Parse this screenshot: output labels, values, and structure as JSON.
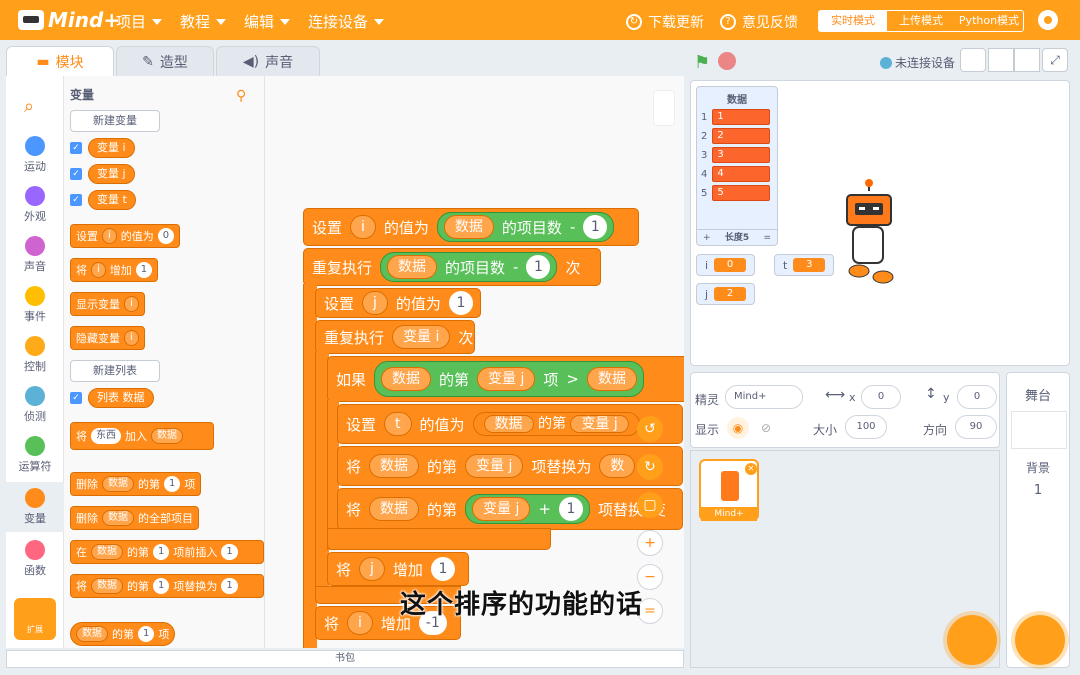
{
  "menubar": {
    "logo_text": "Mind+",
    "menus": [
      "项目",
      "教程",
      "编辑",
      "连接设备"
    ],
    "download_update": "下载更新",
    "feedback": "意见反馈",
    "modes": [
      "实时模式",
      "上传模式",
      "Python模式"
    ],
    "active_mode": "实时模式"
  },
  "tabs": {
    "blocks": "模块",
    "costumes": "造型",
    "sounds": "声音"
  },
  "categories": [
    {
      "label": "运动",
      "color": "#4c97ff"
    },
    {
      "label": "外观",
      "color": "#9966ff"
    },
    {
      "label": "声音",
      "color": "#cf63cf"
    },
    {
      "label": "事件",
      "color": "#ffbf00"
    },
    {
      "label": "控制",
      "color": "#ffab19"
    },
    {
      "label": "侦测",
      "color": "#5cb1d6"
    },
    {
      "label": "运算符",
      "color": "#59c059"
    },
    {
      "label": "变量",
      "color": "#ff8c1a"
    },
    {
      "label": "函数",
      "color": "#ff6680"
    }
  ],
  "extensions_label": "扩展",
  "palette": {
    "title": "变量",
    "new_variable": "新建变量",
    "variables": [
      "变量 i",
      "变量 j",
      "变量 t"
    ],
    "set_block": {
      "a": "设置",
      "var": "i",
      "b": "的值为",
      "val": "0"
    },
    "change_block": {
      "a": "将",
      "var": "i",
      "b": "增加",
      "val": "1"
    },
    "show_block": {
      "a": "显示变量",
      "var": "i"
    },
    "hide_block": {
      "a": "隐藏变量",
      "var": "i"
    },
    "new_list": "新建列表",
    "list_reporter": "列表 数据",
    "add_block": {
      "a": "将",
      "val": "东西",
      "b": "加入",
      "list": "数据"
    },
    "delete_block": {
      "a": "删除",
      "list": "数据",
      "b": "的第",
      "val": "1",
      "c": "项"
    },
    "delete_all_block": {
      "a": "删除",
      "list": "数据",
      "b": "的全部项目"
    },
    "insert_block": {
      "a": "在",
      "list": "数据",
      "b": "的第",
      "val": "1",
      "c": "项前插入",
      "d": "1"
    },
    "replace_block": {
      "a": "将",
      "list": "数据",
      "b": "的第",
      "val": "1",
      "c": "项替换为",
      "d": "1"
    },
    "item_reporter": {
      "list": "数据",
      "b": "的第",
      "val": "1",
      "c": "项"
    }
  },
  "code": {
    "b1": {
      "a": "设置",
      "var": "i",
      "b": "的值为",
      "list": "数据",
      "c": "的项目数",
      "op": "-",
      "val": "1"
    },
    "b2": {
      "a": "重复执行",
      "list": "数据",
      "c": "的项目数",
      "op": "-",
      "val": "1",
      "d": "次"
    },
    "b3": {
      "a": "设置",
      "var": "j",
      "b": "的值为",
      "val": "1"
    },
    "b4": {
      "a": "重复执行",
      "var": "变量 i",
      "d": "次"
    },
    "b5": {
      "a": "如果",
      "list": "数据",
      "b": "的第",
      "var": "变量 j",
      "c": "项",
      "op": ">",
      "list2": "数据"
    },
    "b6": {
      "a": "设置",
      "var": "t",
      "b": "的值为",
      "list": "数据",
      "c": "的第",
      "v": "变量 j"
    },
    "b7": {
      "a": "将",
      "list": "数据",
      "b": "的第",
      "var": "变量 j",
      "c": "项替换为",
      "d": "数"
    },
    "b8": {
      "a": "将",
      "list": "数据",
      "b": "的第",
      "var": "变量 j",
      "op": "+",
      "val": "1",
      "c": "项替换",
      "d": "变"
    },
    "b9": {
      "a": "将",
      "var": "j",
      "b": "增加",
      "val": "1"
    },
    "b10": {
      "a": "将",
      "var": "i",
      "b": "增加",
      "val": "-1"
    }
  },
  "subtitle": "这个排序的功能的话",
  "backpack": "书包",
  "stage_header": {
    "device_status": "未连接设备"
  },
  "list_monitor": {
    "title": "数据",
    "items": [
      "1",
      "2",
      "3",
      "4",
      "5"
    ],
    "footer_add": "+",
    "length": "长度5",
    "footer_resize": "="
  },
  "var_monitors": [
    {
      "name": "i",
      "value": "0"
    },
    {
      "name": "t",
      "value": "3"
    },
    {
      "name": "j",
      "value": "2"
    }
  ],
  "sprite_info": {
    "sprite_label": "精灵",
    "sprite_name": "Mind+",
    "x_label": "x",
    "x": "0",
    "y_label": "y",
    "y": "0",
    "show_label": "显示",
    "size_label": "大小",
    "size": "100",
    "direction_label": "方向",
    "direction": "90"
  },
  "sprite_card": "Mind+",
  "stage_panel": {
    "title": "舞台",
    "backdrop_label": "背景",
    "backdrop_count": "1"
  }
}
